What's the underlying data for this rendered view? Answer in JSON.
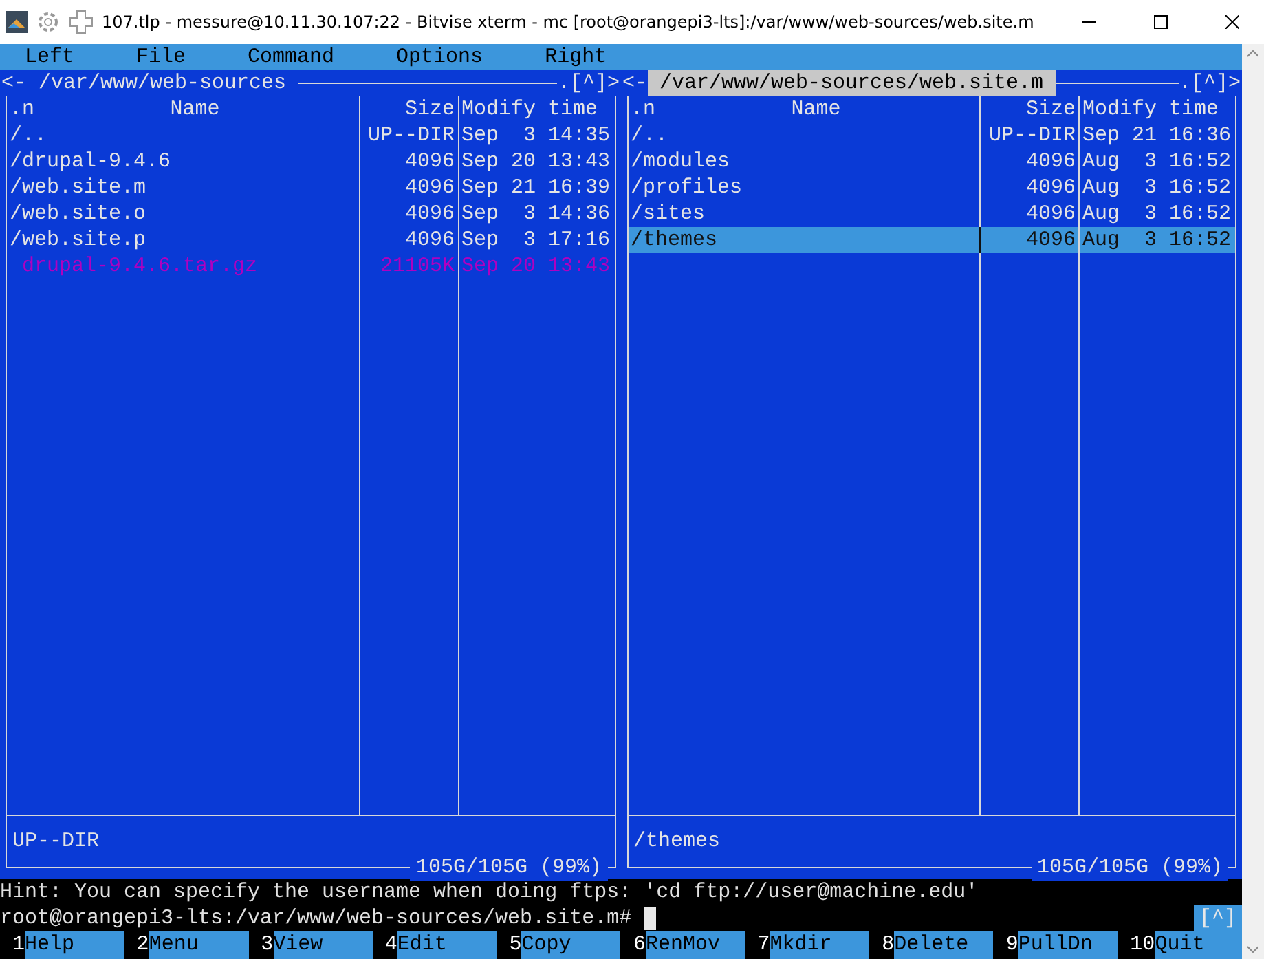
{
  "window": {
    "title": "107.tlp - messure@10.11.30.107:22 - Bitvise xterm - mc [root@orangepi3-lts]:/var/www/web-sources/web.site.m"
  },
  "menu": [
    "Left",
    "File",
    "Command",
    "Options",
    "Right"
  ],
  "panels": [
    {
      "path": "/var/www/web-sources",
      "active": false,
      "back": "<-",
      "corner": ".[^]>",
      "columns": [
        ".n",
        "Name",
        "Size",
        "Modify time"
      ],
      "rows": [
        {
          "name": "/..",
          "size": "UP--DIR",
          "modified": "Sep  3 14:35",
          "kind": "dir",
          "selected": false
        },
        {
          "name": "/drupal-9.4.6",
          "size": "4096",
          "modified": "Sep 20 13:43",
          "kind": "dir",
          "selected": false
        },
        {
          "name": "/web.site.m",
          "size": "4096",
          "modified": "Sep 21 16:39",
          "kind": "dir",
          "selected": false
        },
        {
          "name": "/web.site.o",
          "size": "4096",
          "modified": "Sep  3 14:36",
          "kind": "dir",
          "selected": false
        },
        {
          "name": "/web.site.p",
          "size": "4096",
          "modified": "Sep  3 17:16",
          "kind": "dir",
          "selected": false
        },
        {
          "name": " drupal-9.4.6.tar.gz",
          "size": "21105K",
          "modified": "Sep 20 13:43",
          "kind": "archive",
          "selected": false
        }
      ],
      "status": "UP--DIR",
      "free": "105G/105G (99%)"
    },
    {
      "path": "/var/www/web-sources/web.site.m",
      "active": true,
      "back": "<-",
      "corner": ".[^]>",
      "columns": [
        ".n",
        "Name",
        "Size",
        "Modify time"
      ],
      "rows": [
        {
          "name": "/..",
          "size": "UP--DIR",
          "modified": "Sep 21 16:36",
          "kind": "dir",
          "selected": false
        },
        {
          "name": "/modules",
          "size": "4096",
          "modified": "Aug  3 16:52",
          "kind": "dir",
          "selected": false
        },
        {
          "name": "/profiles",
          "size": "4096",
          "modified": "Aug  3 16:52",
          "kind": "dir",
          "selected": false
        },
        {
          "name": "/sites",
          "size": "4096",
          "modified": "Aug  3 16:52",
          "kind": "dir",
          "selected": false
        },
        {
          "name": "/themes",
          "size": "4096",
          "modified": "Aug  3 16:52",
          "kind": "dir",
          "selected": true
        }
      ],
      "status": "/themes",
      "free": "105G/105G (99%)"
    }
  ],
  "hint": "Hint: You can specify the username when doing ftps: 'cd ftp://user@machine.edu'",
  "prompt": "root@orangepi3-lts:/var/www/web-sources/web.site.m#",
  "corner": "[^]",
  "fkeys": [
    {
      "num": "1",
      "label": "Help"
    },
    {
      "num": "2",
      "label": "Menu"
    },
    {
      "num": "3",
      "label": "View"
    },
    {
      "num": "4",
      "label": "Edit"
    },
    {
      "num": "5",
      "label": "Copy"
    },
    {
      "num": "6",
      "label": "RenMov"
    },
    {
      "num": "7",
      "label": "Mkdir"
    },
    {
      "num": "8",
      "label": "Delete"
    },
    {
      "num": "9",
      "label": "PullDn"
    },
    {
      "num": "10",
      "label": "Quit"
    }
  ]
}
